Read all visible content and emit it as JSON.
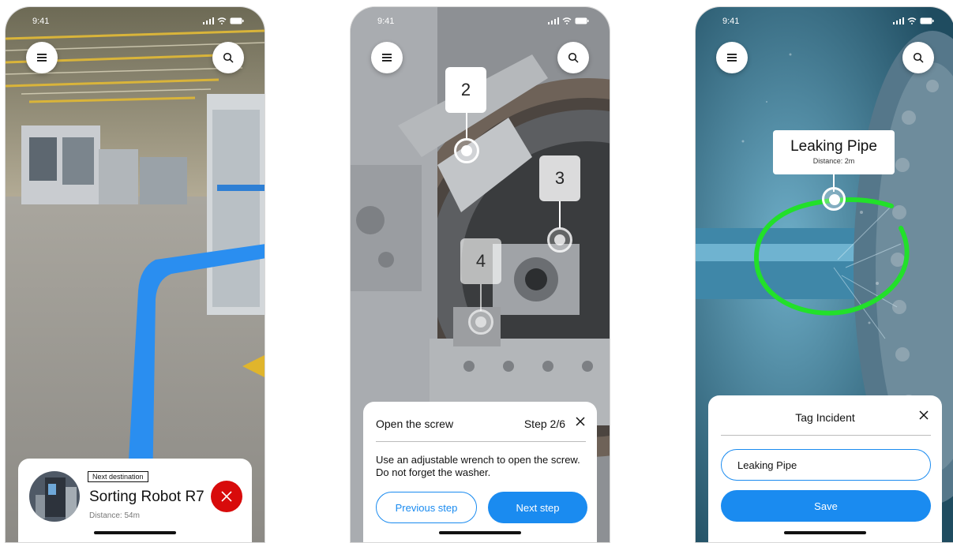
{
  "status_bar": {
    "time": "9:41"
  },
  "screen_navigation": {
    "next_destination_label": "Next destination",
    "destination_name": "Sorting Robot R7",
    "distance_text": "Distance: 54m"
  },
  "screen_repair": {
    "markers": [
      "2",
      "3",
      "4"
    ],
    "step_title": "Open the screw",
    "step_counter": "Step 2/6",
    "step_description": "Use an adjustable wrench to open the screw. Do not forget the washer.",
    "previous_label": "Previous step",
    "next_label": "Next step"
  },
  "screen_incident": {
    "ar_label_title": "Leaking Pipe",
    "ar_label_distance": "Distance: 2m",
    "sheet_title": "Tag Incident",
    "input_value": "Leaking Pipe",
    "save_label": "Save"
  },
  "colors": {
    "accent_blue": "#1a8bf0",
    "close_red": "#d80b0b",
    "ar_highlight_green": "#22e02a"
  },
  "icons": [
    "menu-icon",
    "search-icon",
    "close-icon",
    "signal-icon",
    "wifi-icon",
    "battery-icon"
  ]
}
